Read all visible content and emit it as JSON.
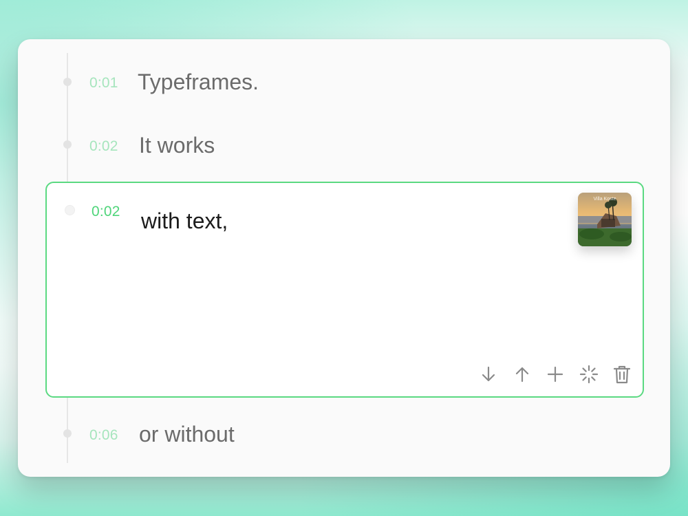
{
  "entries": [
    {
      "time": "0:01",
      "text": "Typeframes."
    },
    {
      "time": "0:02",
      "text": "It works"
    },
    {
      "time": "0:02",
      "text": "with text,"
    },
    {
      "time": "0:06",
      "text": "or without"
    }
  ],
  "active_entry": {
    "thumbnail_caption": "Villa Koste"
  },
  "toolbar": {
    "icons": [
      "arrow-down-icon",
      "arrow-up-icon",
      "plus-icon",
      "loading-spinner-icon",
      "trash-icon"
    ]
  },
  "colors": {
    "accent": "#4fd57a",
    "accent_border": "#5ad981",
    "time_muted": "#a6e5bd",
    "text_muted": "#6b6b6b",
    "text_active": "#1c1c1c"
  }
}
